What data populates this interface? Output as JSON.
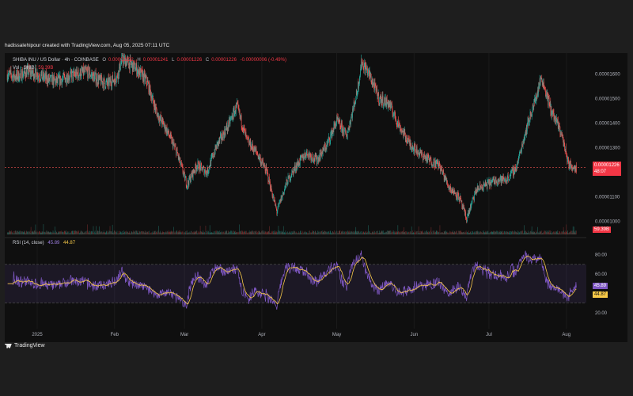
{
  "caption": "hadissalehipour created with TradingView.com, Aug 05, 2025 07:11 UTC",
  "legend": {
    "symbol": "SHIBA INU / US Dollar · 4h · COINBASE",
    "o_label": "O",
    "o_value": "0.00001232",
    "h_label": "H",
    "h_value": "0.00001241",
    "l_label": "L",
    "l_value": "0.00001226",
    "c_label": "C",
    "c_value": "0.00001226",
    "change": "-0.00000006 (-0.49%)",
    "vol_label": "Vol · SHIB",
    "vol_value": "59.39B"
  },
  "rsi_legend": {
    "label": "RSI (14, close)",
    "rsi_value": "45.89",
    "ma_value": "44.87"
  },
  "price_tag": {
    "price": "0.00001226",
    "timer": "48:07"
  },
  "vol_tag": "59.39B",
  "rsi_tags": {
    "rsi": "45.89",
    "ma": "44.87"
  },
  "branding": "TradingView",
  "colors": {
    "up": "#26a69a",
    "down": "#ef5350",
    "rsi": "#7e57c2",
    "rsi_ma": "#f7c948",
    "background": "#0f0f0f",
    "price_line": "#ef5350"
  },
  "chart_data": [
    {
      "type": "candlestick",
      "title": "SHIBA INU / US Dollar · 4h · COINBASE",
      "x_tick_labels": [
        "2025",
        "Feb",
        "Mar",
        "Apr",
        "May",
        "Jun",
        "Jul",
        "Aug"
      ],
      "y_tick_labels": [
        "0.00001600",
        "0.00001500",
        "0.00001400",
        "0.00001300",
        "0.00001100",
        "0.00001000"
      ],
      "ylim": [
        9.6e-06,
        1.67e-05
      ],
      "x": [
        "2024-12-20",
        "2024-12-24",
        "2024-12-28",
        "2025-01-01",
        "2025-01-05",
        "2025-01-09",
        "2025-01-13",
        "2025-01-17",
        "2025-01-21",
        "2025-01-25",
        "2025-01-29",
        "2025-02-02",
        "2025-02-04",
        "2025-02-06",
        "2025-02-10",
        "2025-02-14",
        "2025-02-18",
        "2025-02-22",
        "2025-02-26",
        "2025-03-02",
        "2025-03-06",
        "2025-03-10",
        "2025-03-14",
        "2025-03-18",
        "2025-03-22",
        "2025-03-26",
        "2025-03-30",
        "2025-04-03",
        "2025-04-07",
        "2025-04-11",
        "2025-04-15",
        "2025-04-19",
        "2025-04-23",
        "2025-04-27",
        "2025-05-01",
        "2025-05-05",
        "2025-05-09",
        "2025-05-11",
        "2025-05-14",
        "2025-05-18",
        "2025-05-22",
        "2025-05-26",
        "2025-05-30",
        "2025-06-03",
        "2025-06-07",
        "2025-06-11",
        "2025-06-15",
        "2025-06-19",
        "2025-06-22",
        "2025-06-26",
        "2025-06-30",
        "2025-07-04",
        "2025-07-08",
        "2025-07-12",
        "2025-07-16",
        "2025-07-20",
        "2025-07-22",
        "2025-07-26",
        "2025-07-30",
        "2025-08-02",
        "2025-08-05"
      ],
      "close": [
        1.6e-05,
        1.59e-05,
        1.61e-05,
        1.6e-05,
        1.58e-05,
        1.57e-05,
        1.59e-05,
        1.6e-05,
        1.61e-05,
        1.58e-05,
        1.56e-05,
        1.59e-05,
        1.66e-05,
        1.65e-05,
        1.62e-05,
        1.57e-05,
        1.44e-05,
        1.37e-05,
        1.28e-05,
        1.15e-05,
        1.23e-05,
        1.2e-05,
        1.31e-05,
        1.38e-05,
        1.47e-05,
        1.33e-05,
        1.28e-05,
        1.2e-05,
        1.04e-05,
        1.16e-05,
        1.23e-05,
        1.28e-05,
        1.25e-05,
        1.31e-05,
        1.41e-05,
        1.35e-05,
        1.52e-05,
        1.65e-05,
        1.6e-05,
        1.5e-05,
        1.48e-05,
        1.39e-05,
        1.32e-05,
        1.28e-05,
        1.25e-05,
        1.23e-05,
        1.14e-05,
        1.1e-05,
        1.01e-05,
        1.13e-05,
        1.15e-05,
        1.17e-05,
        1.17e-05,
        1.22e-05,
        1.38e-05,
        1.51e-05,
        1.59e-05,
        1.45e-05,
        1.36e-05,
        1.23e-05,
        1.22e-05
      ],
      "rsi_ylim": [
        10,
        92
      ],
      "rsi_y_tick_labels": [
        "80.00",
        "60.00",
        "20.00"
      ],
      "rsi_bands": [
        70,
        30
      ],
      "last_rsi": 45.89,
      "last_rsi_ma": 44.87
    }
  ]
}
